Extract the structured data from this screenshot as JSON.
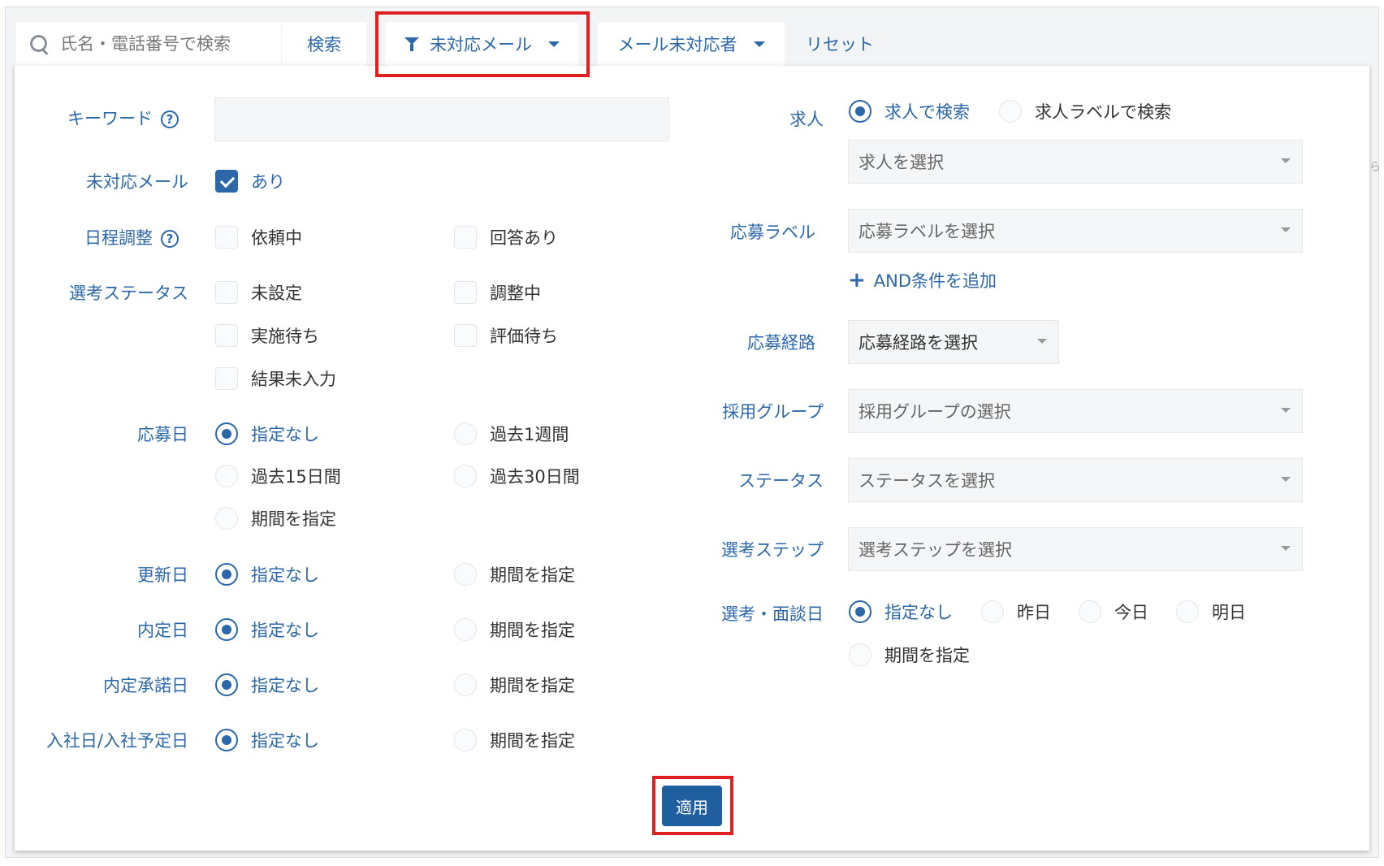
{
  "toolbar": {
    "search_placeholder": "氏名・電話番号で検索",
    "search_button": "検索",
    "filter_button": "未対応メール",
    "assignee_button": "メール未対応者",
    "reset_link": "リセット"
  },
  "filter": {
    "keyword": {
      "label": "キーワード",
      "value": ""
    },
    "unread_mail": {
      "label": "未対応メール",
      "option": "あり",
      "checked": true
    },
    "schedule": {
      "label": "日程調整",
      "options": [
        "依頼中",
        "回答あり"
      ]
    },
    "selection_status": {
      "label": "選考ステータス",
      "options": [
        "未設定",
        "調整中",
        "実施待ち",
        "評価待ち",
        "結果未入力"
      ]
    },
    "applied_date": {
      "label": "応募日",
      "options": [
        "指定なし",
        "過去1週間",
        "過去15日間",
        "過去30日間",
        "期間を指定"
      ],
      "selected": "指定なし"
    },
    "updated_date": {
      "label": "更新日",
      "options": [
        "指定なし",
        "期間を指定"
      ],
      "selected": "指定なし"
    },
    "offer_date": {
      "label": "内定日",
      "options": [
        "指定なし",
        "期間を指定"
      ],
      "selected": "指定なし"
    },
    "offer_accept_date": {
      "label": "内定承諾日",
      "options": [
        "指定なし",
        "期間を指定"
      ],
      "selected": "指定なし"
    },
    "join_date": {
      "label": "入社日/入社予定日",
      "options": [
        "指定なし",
        "期間を指定"
      ],
      "selected": "指定なし"
    },
    "job": {
      "label": "求人",
      "options": [
        "求人で検索",
        "求人ラベルで検索"
      ],
      "selected": "求人で検索",
      "select_placeholder": "求人を選択"
    },
    "apply_label": {
      "label": "応募ラベル",
      "select_placeholder": "応募ラベルを選択",
      "add_condition": "AND条件を追加"
    },
    "apply_route": {
      "label": "応募経路",
      "select_placeholder": "応募経路を選択"
    },
    "hiring_group": {
      "label": "採用グループ",
      "select_placeholder": "採用グループの選択"
    },
    "status": {
      "label": "ステータス",
      "select_placeholder": "ステータスを選択"
    },
    "selection_step": {
      "label": "選考ステップ",
      "select_placeholder": "選考ステップを選択"
    },
    "interview_date": {
      "label": "選考・面談日",
      "options": [
        "指定なし",
        "昨日",
        "今日",
        "明日",
        "期間を指定"
      ],
      "selected": "指定なし"
    },
    "apply_button": "適用"
  },
  "colors": {
    "accent": "#2c67a8",
    "highlight": "#e02020",
    "apply_bg": "#1f5fa0"
  }
}
